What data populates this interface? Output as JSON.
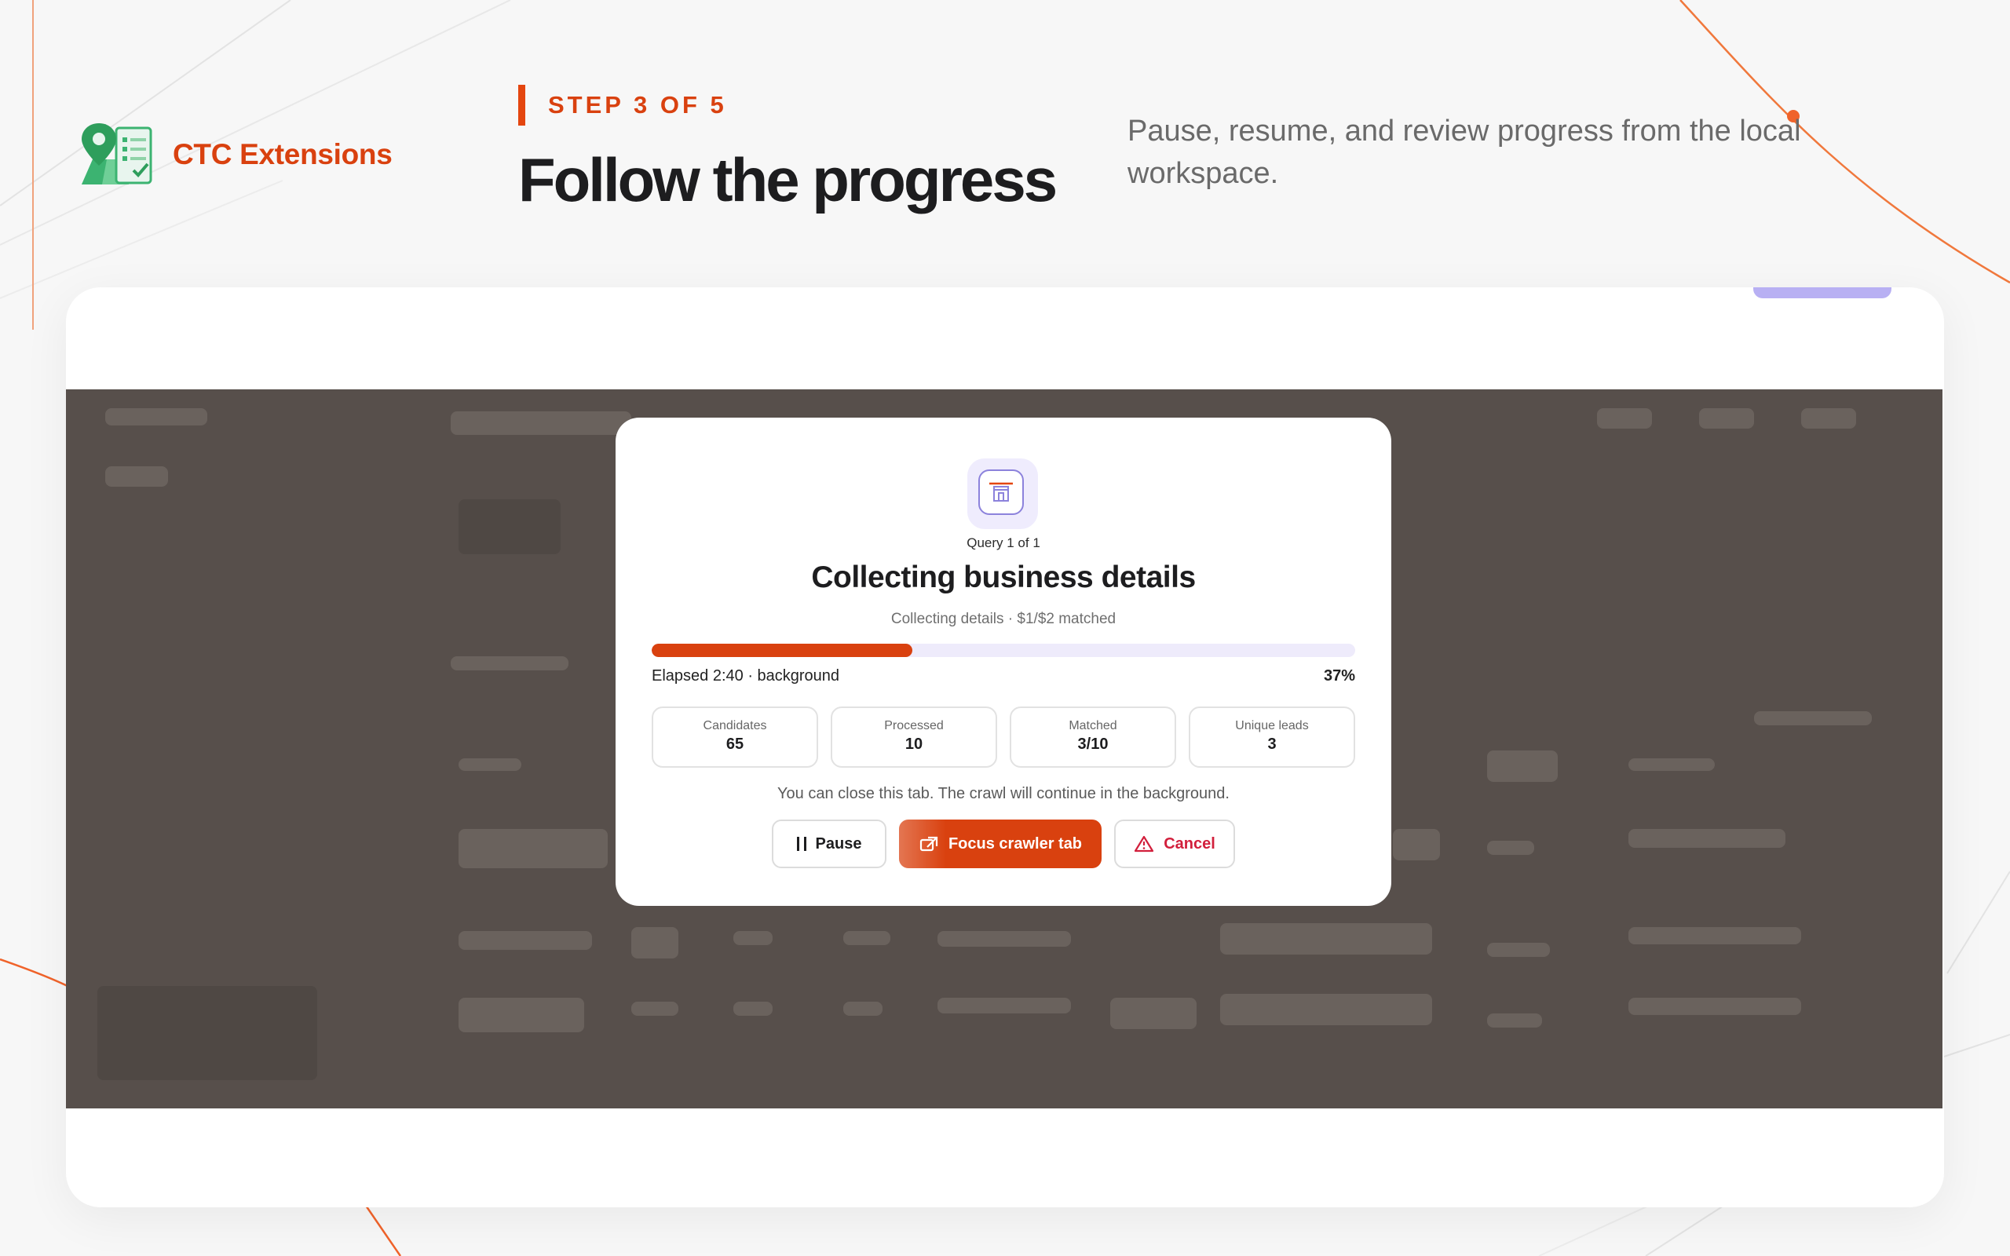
{
  "brand": {
    "name": "CTC Extensions",
    "logo_icon": "map-pin-checklist-icon"
  },
  "header": {
    "step_label": "STEP 3 OF 5",
    "title": "Follow the progress",
    "subtitle": "Pause, resume, and review progress from the local workspace."
  },
  "modal": {
    "icon": "storefront-icon",
    "query_label": "Query 1 of 1",
    "title": "Collecting business details",
    "status": "Collecting details · $1/$2 matched",
    "progress_percent": 37,
    "elapsed": "Elapsed 2:40 · background",
    "percent_label": "37%",
    "stats": [
      {
        "label": "Candidates",
        "value": "65"
      },
      {
        "label": "Processed",
        "value": "10"
      },
      {
        "label": "Matched",
        "value": "3/10"
      },
      {
        "label": "Unique leads",
        "value": "3"
      }
    ],
    "note": "You can close this tab. The crawl will continue in the background.",
    "buttons": {
      "pause": "Pause",
      "focus": "Focus crawler tab",
      "cancel": "Cancel"
    }
  },
  "colors": {
    "accent": "#d9410f",
    "progress_track": "#eeebfb",
    "cancel": "#d21f3c",
    "overlay": "#574f4b",
    "card_tab": "#b8b0f3"
  }
}
